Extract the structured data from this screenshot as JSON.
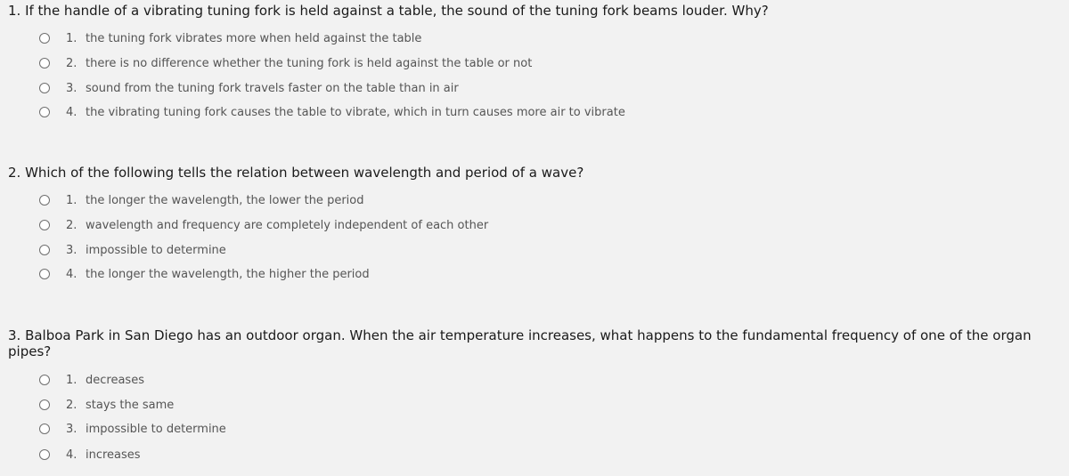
{
  "questions": [
    {
      "text": "1. If the handle of a vibrating tuning fork is held against a table, the sound of the tuning fork beams louder. Why?",
      "options": [
        {
          "num": "1.",
          "text": "the tuning fork vibrates more when held against the table"
        },
        {
          "num": "2.",
          "text": "there is no difference whether the tuning fork is held against the table or not"
        },
        {
          "num": "3.",
          "text": "sound from the tuning fork travels faster on the table than in air"
        },
        {
          "num": "4.",
          "text": "the vibrating tuning fork causes the table to vibrate, which in turn causes more air to vibrate"
        }
      ]
    },
    {
      "text": "2. Which of the following tells the relation between wavelength and period of a wave?",
      "options": [
        {
          "num": "1.",
          "text": "the longer the wavelength, the lower the period"
        },
        {
          "num": "2.",
          "text": "wavelength and frequency are completely independent of each other"
        },
        {
          "num": "3.",
          "text": "impossible to determine"
        },
        {
          "num": "4.",
          "text": "the longer the wavelength, the higher the period"
        }
      ]
    },
    {
      "text": "3. Balboa Park in San Diego has an outdoor organ. When the air temperature increases, what happens to the fundamental frequency of one of the organ pipes?",
      "options": [
        {
          "num": "1.",
          "text": "decreases"
        },
        {
          "num": "2.",
          "text": "stays the same"
        },
        {
          "num": "3.",
          "text": "impossible to determine"
        },
        {
          "num": "4.",
          "text": "increases"
        }
      ]
    }
  ]
}
